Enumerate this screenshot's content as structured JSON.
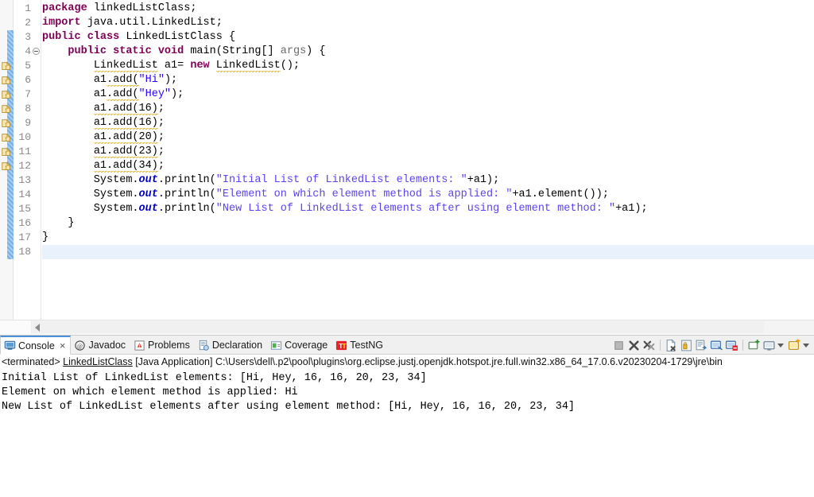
{
  "editor": {
    "first_line": 1,
    "last_line": 18,
    "current_line": 18,
    "fold_marker_line": 4,
    "warning_lines": [
      5,
      6,
      7,
      8,
      9,
      10,
      11,
      12
    ],
    "diff_bar_from_line": 3,
    "diff_bar_to_line": 18,
    "line_numbers": [
      "1",
      "2",
      "3",
      "4",
      "5",
      "6",
      "7",
      "8",
      "9",
      "10",
      "11",
      "12",
      "13",
      "14",
      "15",
      "16",
      "17",
      "18"
    ],
    "code_lines": [
      {
        "n": 1,
        "text": "package linkedListClass;"
      },
      {
        "n": 2,
        "text": "import java.util.LinkedList;"
      },
      {
        "n": 3,
        "text": "public class LinkedListClass {"
      },
      {
        "n": 4,
        "text": "    public static void main(String[] args) {"
      },
      {
        "n": 5,
        "text": "        LinkedList a1= new LinkedList();"
      },
      {
        "n": 6,
        "text": "        a1.add(\"Hi\");"
      },
      {
        "n": 7,
        "text": "        a1.add(\"Hey\");"
      },
      {
        "n": 8,
        "text": "        a1.add(16);"
      },
      {
        "n": 9,
        "text": "        a1.add(16);"
      },
      {
        "n": 10,
        "text": "        a1.add(20);"
      },
      {
        "n": 11,
        "text": "        a1.add(23);"
      },
      {
        "n": 12,
        "text": "        a1.add(34);"
      },
      {
        "n": 13,
        "text": "        System.out.println(\"Initial List of LinkedList elements: \"+a1);"
      },
      {
        "n": 14,
        "text": "        System.out.println(\"Element on which element method is applied: \"+a1.element());"
      },
      {
        "n": 15,
        "text": "        System.out.println(\"New List of LinkedList elements after using element method: \"+a1);"
      },
      {
        "n": 16,
        "text": "    }"
      },
      {
        "n": 17,
        "text": "}"
      },
      {
        "n": 18,
        "text": ""
      }
    ],
    "tokens": {
      "l1": [
        {
          "t": "package",
          "c": "kw"
        },
        {
          "t": " linkedListClass;",
          "c": "plain"
        }
      ],
      "l2": [
        {
          "t": "import",
          "c": "kw"
        },
        {
          "t": " java.util.LinkedList;",
          "c": "plain"
        }
      ],
      "l3": [
        {
          "t": "public class",
          "c": "kw"
        },
        {
          "t": " LinkedListClass {",
          "c": "plain"
        }
      ],
      "l4": [
        {
          "t": "    ",
          "c": "plain"
        },
        {
          "t": "public static void",
          "c": "kw"
        },
        {
          "t": " main(String[] ",
          "c": "plain"
        },
        {
          "t": "args",
          "c": "param"
        },
        {
          "t": ") {",
          "c": "plain"
        }
      ],
      "l5": [
        {
          "t": "        ",
          "c": "plain"
        },
        {
          "t": "LinkedList",
          "c": "warnu"
        },
        {
          "t": " a1= ",
          "c": "plain"
        },
        {
          "t": "new",
          "c": "kw"
        },
        {
          "t": " ",
          "c": "plain"
        },
        {
          "t": "LinkedList",
          "c": "warnu"
        },
        {
          "t": "();",
          "c": "plain"
        }
      ],
      "l6": [
        {
          "t": "        ",
          "c": "plain"
        },
        {
          "t": "a1",
          "c": "plain"
        },
        {
          "t": ".add(",
          "c": "warnu"
        },
        {
          "t": "\"Hi\"",
          "c": "str"
        },
        {
          "t": ");",
          "c": "plain"
        }
      ],
      "l7": [
        {
          "t": "        ",
          "c": "plain"
        },
        {
          "t": "a1",
          "c": "plain"
        },
        {
          "t": ".add(",
          "c": "warnu"
        },
        {
          "t": "\"Hey\"",
          "c": "str"
        },
        {
          "t": ");",
          "c": "plain"
        }
      ],
      "l8": [
        {
          "t": "        ",
          "c": "plain"
        },
        {
          "t": "a1.add(16)",
          "c": "warnu"
        },
        {
          "t": ";",
          "c": "plain"
        }
      ],
      "l9": [
        {
          "t": "        ",
          "c": "plain"
        },
        {
          "t": "a1.add(16)",
          "c": "warnu"
        },
        {
          "t": ";",
          "c": "plain"
        }
      ],
      "l10": [
        {
          "t": "        ",
          "c": "plain"
        },
        {
          "t": "a1.add(20)",
          "c": "warnu"
        },
        {
          "t": ";",
          "c": "plain"
        }
      ],
      "l11": [
        {
          "t": "        ",
          "c": "plain"
        },
        {
          "t": "a1.add(23)",
          "c": "warnu"
        },
        {
          "t": ";",
          "c": "plain"
        }
      ],
      "l12": [
        {
          "t": "        ",
          "c": "plain"
        },
        {
          "t": "a1.add(34)",
          "c": "warnu"
        },
        {
          "t": ";",
          "c": "plain"
        }
      ],
      "l13": [
        {
          "t": "        System.",
          "c": "plain"
        },
        {
          "t": "out",
          "c": "field"
        },
        {
          "t": ".println(",
          "c": "plain"
        },
        {
          "t": "\"Initial List of LinkedList elements: \"",
          "c": "str2"
        },
        {
          "t": "+a1);",
          "c": "plain"
        }
      ],
      "l14": [
        {
          "t": "        System.",
          "c": "plain"
        },
        {
          "t": "out",
          "c": "field"
        },
        {
          "t": ".println(",
          "c": "plain"
        },
        {
          "t": "\"Element on which element method is applied: \"",
          "c": "str2"
        },
        {
          "t": "+a1.element());",
          "c": "plain"
        }
      ],
      "l15": [
        {
          "t": "        System.",
          "c": "plain"
        },
        {
          "t": "out",
          "c": "field"
        },
        {
          "t": ".println(",
          "c": "plain"
        },
        {
          "t": "\"New List of LinkedList elements after using element method: \"",
          "c": "str2"
        },
        {
          "t": "+a1);",
          "c": "plain"
        }
      ],
      "l16": [
        {
          "t": "    }",
          "c": "plain"
        }
      ],
      "l17": [
        {
          "t": "}",
          "c": "plain"
        }
      ],
      "l18": [
        {
          "t": "",
          "c": "plain"
        }
      ]
    },
    "colors": {
      "keyword": "#7f0055",
      "string": "#2a00ff",
      "field": "#0000c0",
      "parameter": "#6a6a6a",
      "current_line_highlight": "#e8f1fc",
      "warning_underline": "#d7b13a",
      "diff_bar": "#79b0e4"
    }
  },
  "console": {
    "tabs": [
      {
        "label": "Console",
        "icon": "console-icon",
        "active": true,
        "closable": true
      },
      {
        "label": "Javadoc",
        "icon": "javadoc-icon",
        "active": false,
        "closable": false
      },
      {
        "label": "Problems",
        "icon": "problems-icon",
        "active": false,
        "closable": false
      },
      {
        "label": "Declaration",
        "icon": "declaration-icon",
        "active": false,
        "closable": false
      },
      {
        "label": "Coverage",
        "icon": "coverage-icon",
        "active": false,
        "closable": false
      },
      {
        "label": "TestNG",
        "icon": "testng-icon",
        "active": false,
        "closable": false
      }
    ],
    "close_glyph": "×",
    "toolbar": [
      {
        "name": "terminate-button",
        "icon": "stop-square-icon"
      },
      {
        "name": "remove-launch-button",
        "icon": "remove-x-icon"
      },
      {
        "name": "remove-all-terminated-button",
        "icon": "remove-all-x-icon"
      },
      {
        "name": "separator-1",
        "icon": "separator"
      },
      {
        "name": "clear-console-button",
        "icon": "clear-console-icon"
      },
      {
        "name": "scroll-lock-button",
        "icon": "scroll-lock-icon"
      },
      {
        "name": "word-wrap-button",
        "icon": "word-wrap-icon"
      },
      {
        "name": "show-console-on-output-button",
        "icon": "show-console-icon"
      },
      {
        "name": "pin-console-button",
        "icon": "pin-console-icon"
      },
      {
        "name": "separator-2",
        "icon": "separator"
      },
      {
        "name": "display-selected-console-button",
        "icon": "display-console-icon"
      },
      {
        "name": "open-console-button",
        "icon": "open-console-icon"
      },
      {
        "name": "open-console-dropdown",
        "icon": "chevron-down-icon"
      },
      {
        "name": "new-console-view-button",
        "icon": "new-console-icon"
      },
      {
        "name": "new-console-view-dropdown",
        "icon": "chevron-down-icon"
      }
    ],
    "header": {
      "status": "<terminated>",
      "process_name": "LinkedListClass",
      "launch_type": "[Java Application]",
      "command_path": "C:\\Users\\dell\\.p2\\pool\\plugins\\org.eclipse.justj.openjdk.hotspot.jre.full.win32.x86_64_17.0.6.v20230204-1729\\jre\\bin"
    },
    "output_lines": [
      "Initial List of LinkedList elements: [Hi, Hey, 16, 16, 20, 23, 34]",
      "Element on which element method is applied: Hi",
      "New List of LinkedList elements after using element method: [Hi, Hey, 16, 16, 20, 23, 34]"
    ]
  }
}
